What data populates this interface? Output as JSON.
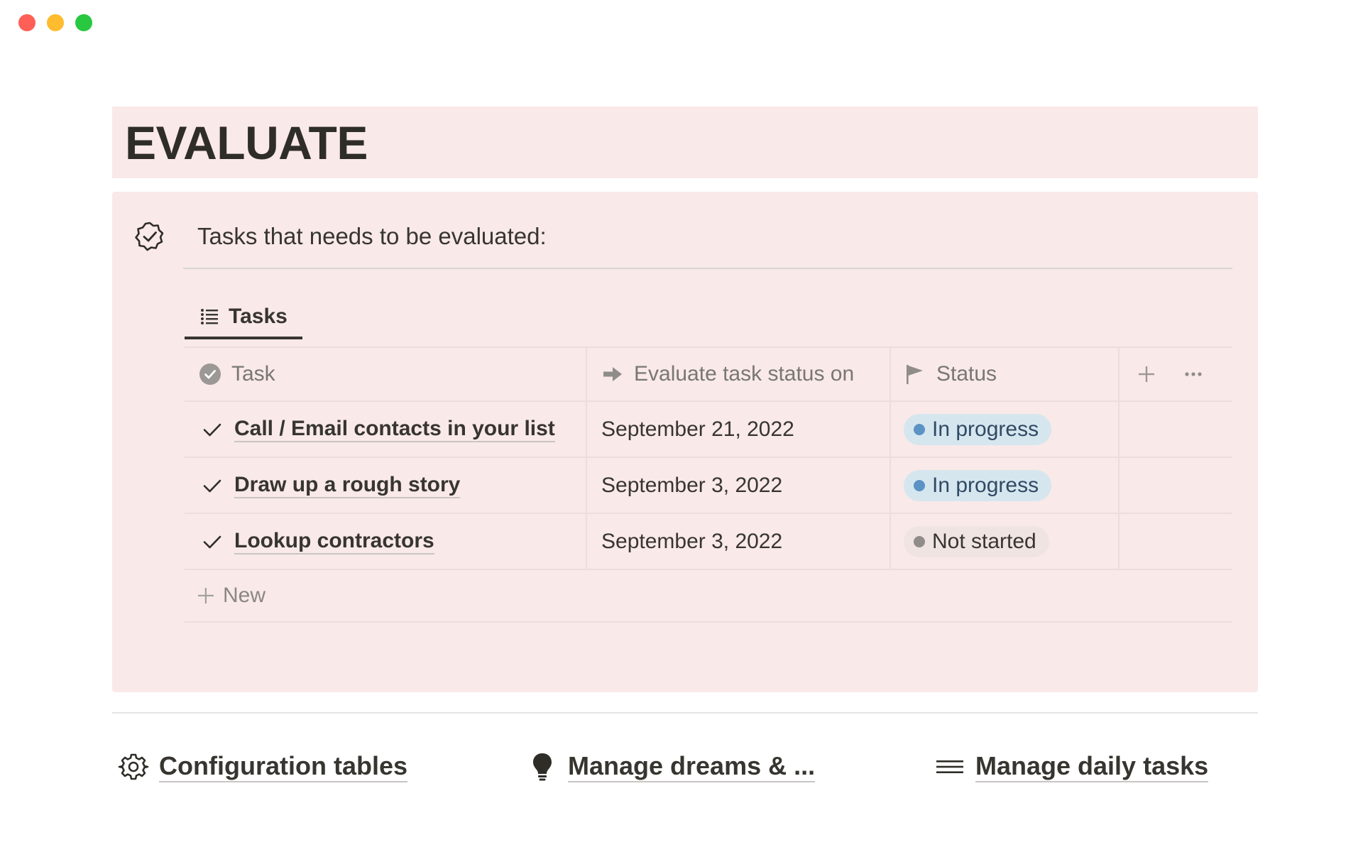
{
  "window": {
    "controls": [
      "close",
      "minimize",
      "zoom"
    ]
  },
  "page": {
    "title": "EVALUATE"
  },
  "callout": {
    "icon": "verified-badge-icon",
    "text": "Tasks that needs to be evaluated:",
    "background": "#f9e9e8"
  },
  "view": {
    "tab_label": "Tasks",
    "tab_icon": "list-icon"
  },
  "table": {
    "columns": [
      {
        "label": "Task",
        "icon": "check-circle-icon"
      },
      {
        "label": "Evaluate task status on",
        "icon": "arrow-right-icon"
      },
      {
        "label": "Status",
        "icon": "flag-icon"
      }
    ],
    "add_column_icon": "plus-icon",
    "more_icon": "more-horizontal-icon",
    "rows": [
      {
        "task": "Call / Email contacts in your list",
        "date": "September 21, 2022",
        "status": "In progress",
        "status_color": "#d6e6ef"
      },
      {
        "task": "Draw up a rough story",
        "date": "September 3, 2022",
        "status": "In progress",
        "status_color": "#d6e6ef"
      },
      {
        "task": "Lookup contractors",
        "date": "September 3, 2022",
        "status": "Not started",
        "status_color": "#f0e4e3"
      }
    ],
    "new_label": "New"
  },
  "links": [
    {
      "label": "Configuration tables",
      "icon": "gear-icon"
    },
    {
      "label": "Manage dreams & ...",
      "icon": "lightbulb-icon"
    },
    {
      "label": "Manage daily tasks",
      "icon": "menu-lines-icon"
    }
  ]
}
